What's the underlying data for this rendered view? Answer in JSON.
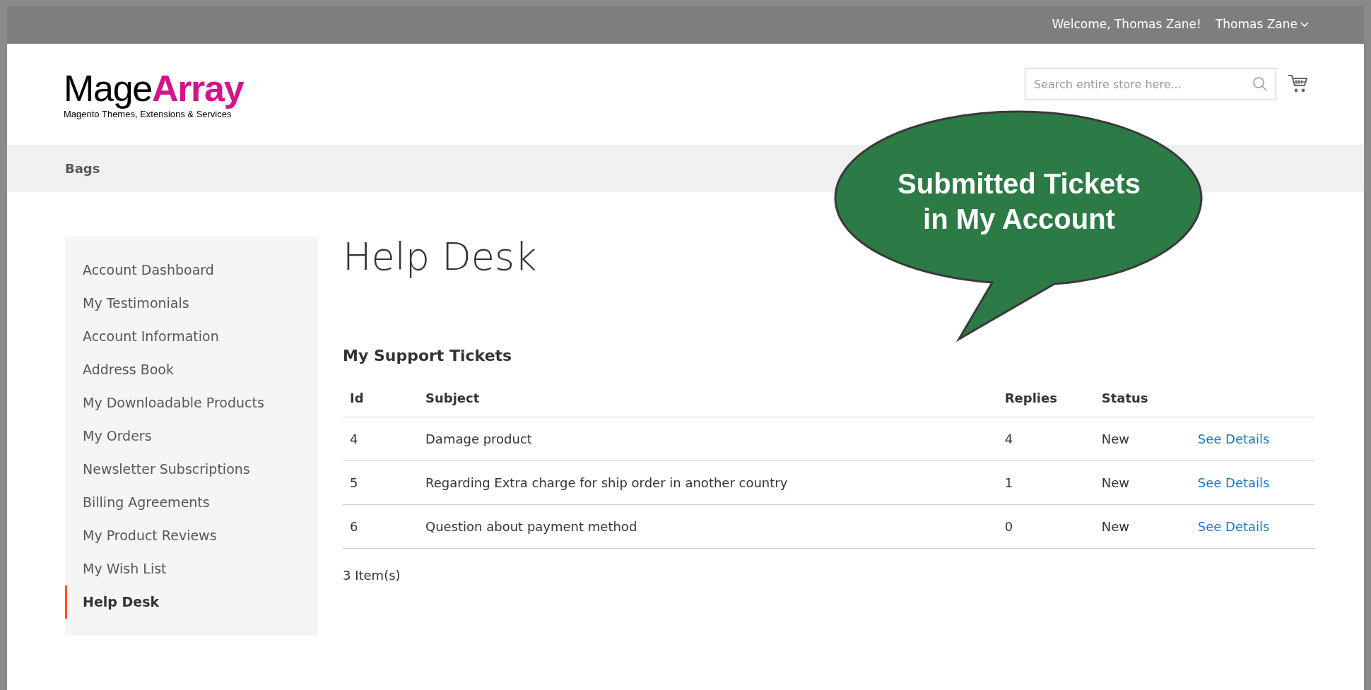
{
  "top_bar": {
    "welcome": "Welcome, Thomas Zane!",
    "account_menu": "Thomas Zane"
  },
  "logo": {
    "part_1": "Mage",
    "part_2": "Array",
    "tagline": "Magento Themes, Extensions & Services"
  },
  "search": {
    "placeholder": "Search entire store here..."
  },
  "nav": {
    "items": [
      "Bags"
    ]
  },
  "callout": {
    "text": "Submitted Tickets in My Account"
  },
  "sidebar": {
    "items": [
      {
        "label": "Account Dashboard",
        "selected": false
      },
      {
        "label": "My Testimonials",
        "selected": false
      },
      {
        "label": "Account Information",
        "selected": false
      },
      {
        "label": "Address Book",
        "selected": false
      },
      {
        "label": "My Downloadable Products",
        "selected": false
      },
      {
        "label": "My Orders",
        "selected": false
      },
      {
        "label": "Newsletter Subscriptions",
        "selected": false
      },
      {
        "label": "Billing Agreements",
        "selected": false
      },
      {
        "label": "My Product Reviews",
        "selected": false
      },
      {
        "label": "My Wish List",
        "selected": false
      },
      {
        "label": "Help Desk",
        "selected": true
      }
    ]
  },
  "page_title": "Help Desk",
  "tickets": {
    "title": "My Support Tickets",
    "columns": [
      "Id",
      "Subject",
      "Replies",
      "Status"
    ],
    "rows": [
      {
        "id": "4",
        "subject": "Damage product",
        "replies": "4",
        "status": "New",
        "action": "See Details"
      },
      {
        "id": "5",
        "subject": "Regarding Extra charge for ship order in another country",
        "replies": "1",
        "status": "New",
        "action": "See Details"
      },
      {
        "id": "6",
        "subject": "Question about payment method",
        "replies": "0",
        "status": "New",
        "action": "See Details"
      }
    ],
    "count": "3 Item(s)"
  }
}
